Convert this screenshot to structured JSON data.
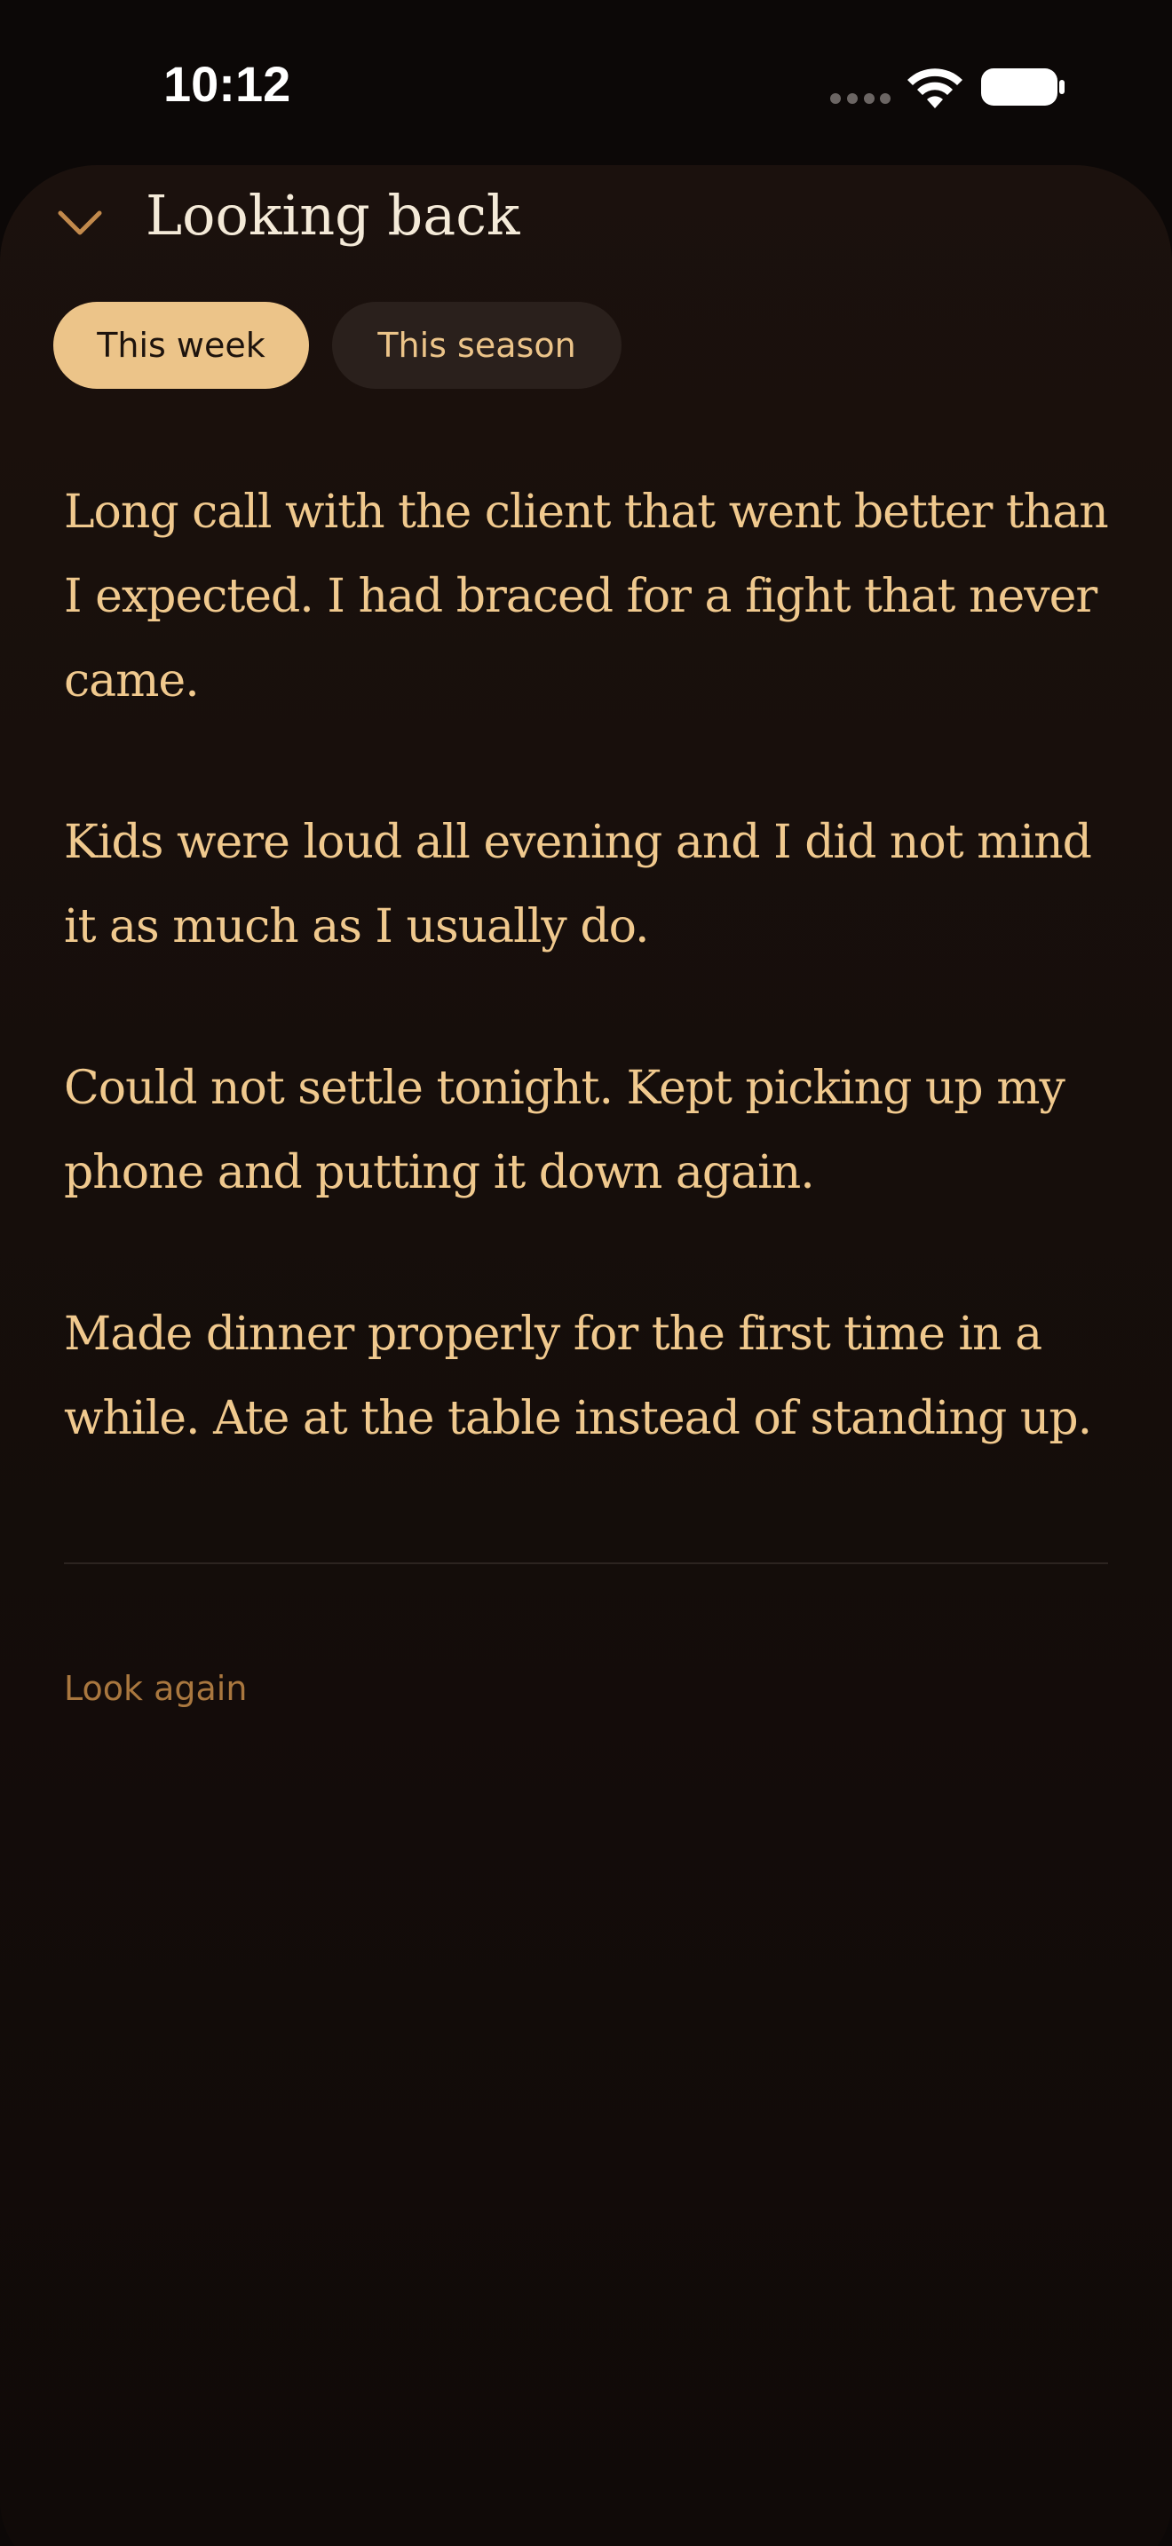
{
  "status_bar": {
    "time": "10:12",
    "icons": [
      "signal-dots-icon",
      "wifi-icon",
      "battery-icon"
    ]
  },
  "sheet": {
    "title": "Looking back",
    "collapse_icon": "chevron-down-icon",
    "tabs": [
      {
        "label": "This week",
        "selected": true
      },
      {
        "label": "This season",
        "selected": false
      }
    ],
    "entries": [
      "Long call with the client that went better than I expected. I had braced for a fight that never came.",
      "Kids were loud all evening and I did not mind it as much as I usually do.",
      "Could not settle tonight. Kept picking up my phone and putting it down again.",
      "Made dinner properly for the first time in a while. Ate at the table instead of standing up."
    ],
    "action_label": "Look again"
  },
  "colors": {
    "background": "#0c0807",
    "sheet": "#1b110d",
    "accent": "#ecc489",
    "entry_text": "#f0c98e",
    "link": "#a9773f",
    "title": "#f4ead8"
  }
}
